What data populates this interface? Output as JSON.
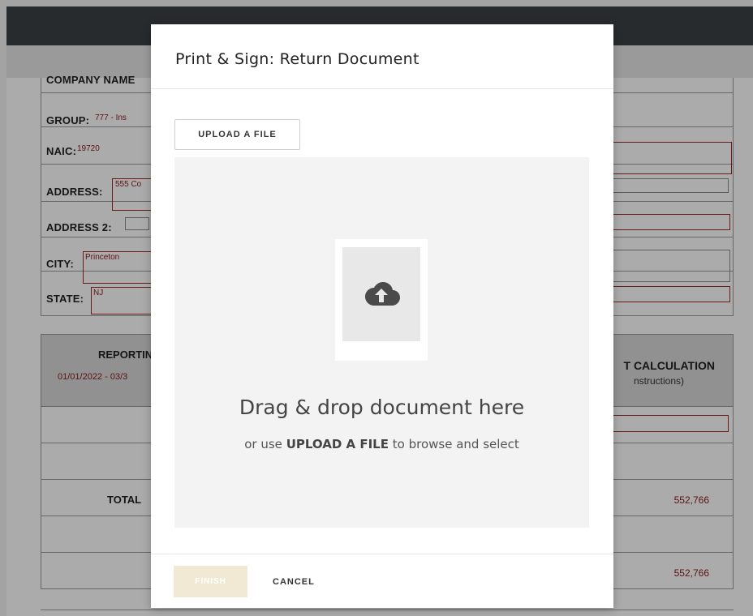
{
  "background_form": {
    "company_label": "COMPANY NAME",
    "group_label": "GROUP:",
    "group_value": "777 - Ins",
    "naic_label": "NAIC:",
    "naic_value": "19720",
    "address_label": "ADDRESS:",
    "address_value": "555 Co",
    "address2_label": "ADDRESS 2:",
    "city_label": "CITY:",
    "city_value": "Princeton",
    "state_label": "STATE:",
    "state_value": "NJ"
  },
  "background_table": {
    "reporting_header": "REPORTIN",
    "date_range": "01/01/2022 - 03/3",
    "calc_header": "T CALCULATION",
    "calc_sub": "nstructions)",
    "total_label": "TOTAL",
    "total_value_1": "552,766",
    "total_value_2": "552,766"
  },
  "modal": {
    "title": "Print & Sign: Return Document",
    "upload_button": "UPLOAD A FILE",
    "upload_icon": "cloud-upload-icon",
    "drop_title": "Drag & drop document here",
    "drop_sub_prefix": "or use",
    "drop_sub_bold": "UPLOAD A FILE",
    "drop_sub_suffix": "to browse and select",
    "finish_button": "FINISH",
    "cancel_button": "CANCEL"
  },
  "colors": {
    "topbar": "#3b4144",
    "field_red": "#9b2a2a",
    "finish_disabled": "#f1e9d4"
  }
}
